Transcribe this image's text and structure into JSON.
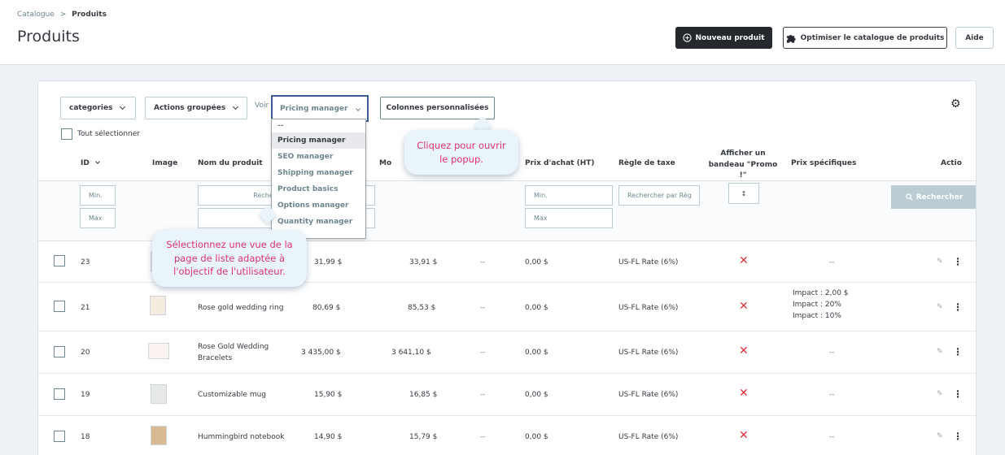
{
  "breadcrumb": {
    "parent": "Catalogue",
    "separator": ">",
    "current": "Produits"
  },
  "page_title": "Produits",
  "toolbar": {
    "new_product": "Nouveau produit",
    "optimize": "Optimiser le catalogue de produits",
    "help": "Aide"
  },
  "controls": {
    "categories": "categories",
    "bulk_actions": "Actions groupées",
    "view_label": "Voir",
    "view_selected": "Pricing manager",
    "custom_columns": "Colonnes personnalisées",
    "select_all": "Tout sélectionner"
  },
  "view_options": [
    "--",
    "Pricing manager",
    "SEO manager",
    "Shipping manager",
    "Product basics",
    "Options manager",
    "Quantity manager"
  ],
  "columns": {
    "id": "ID",
    "image": "Image",
    "name": "Nom du produit",
    "price_short": "Mo",
    "purchase_price": "Prix d'achat (HT)",
    "tax_rule": "Règle de taxe",
    "promo_banner": "Afficher un bandeau \"Promo !\"",
    "specific_prices": "Prix spécifiques",
    "actions": "Actio"
  },
  "filters": {
    "min": "Min.",
    "max": "Max",
    "search_name": "Rechercher par nom",
    "search_tax": "Rechercher par Règ",
    "search_button": "Rechercher",
    "promo_select": "↕"
  },
  "products": [
    {
      "id": "23",
      "name": "",
      "price": "31,99 $",
      "price_ttc": "33,91 $",
      "col3": "--",
      "purchase": "0,00 $",
      "tax": "US-FL Rate (6%)",
      "specific": [
        "--"
      ]
    },
    {
      "id": "21",
      "name": "Rose gold wedding ring",
      "price": "80,69 $",
      "price_ttc": "85,53 $",
      "col3": "--",
      "purchase": "0,00 $",
      "tax": "US-FL Rate (6%)",
      "specific": [
        "Impact : 2,00 $",
        "Impact : 20%",
        "Impact : 10%"
      ]
    },
    {
      "id": "20",
      "name": "Rose Gold Wedding Bracelets",
      "price": "3 435,00 $",
      "price_ttc": "3 641,10 $",
      "col3": "--",
      "purchase": "0,00 $",
      "tax": "US-FL Rate (6%)",
      "specific": [
        "--"
      ]
    },
    {
      "id": "19",
      "name": "Customizable mug",
      "price": "15,90 $",
      "price_ttc": "16,85 $",
      "col3": "--",
      "purchase": "0,00 $",
      "tax": "US-FL Rate (6%)",
      "specific": [
        "--"
      ]
    },
    {
      "id": "18",
      "name": "Hummingbird notebook",
      "price": "14,90 $",
      "price_ttc": "15,79 $",
      "col3": "--",
      "purchase": "0,00 $",
      "tax": "US-FL Rate (6%)",
      "specific": [
        "--"
      ]
    }
  ],
  "callouts": {
    "popup": "Cliquez pour ouvrir le popup.",
    "view": "Sélectionnez une vue de la page de liste adaptée à l'objectif de l'utilisateur."
  },
  "colors": {
    "dark_button": "#25282c",
    "callout_text": "#e0326e",
    "callout_bg": "#e9f5fb",
    "red_x": "#e0323d",
    "select_border": "#3b5a9a"
  },
  "icons": {
    "new_product": "plus-circle-icon",
    "optimize": "puzzle-icon",
    "settings": "gear-icon",
    "search": "search-icon",
    "edit": "edit-icon",
    "more": "kebab-icon",
    "promo_no": "x-mark-icon"
  }
}
